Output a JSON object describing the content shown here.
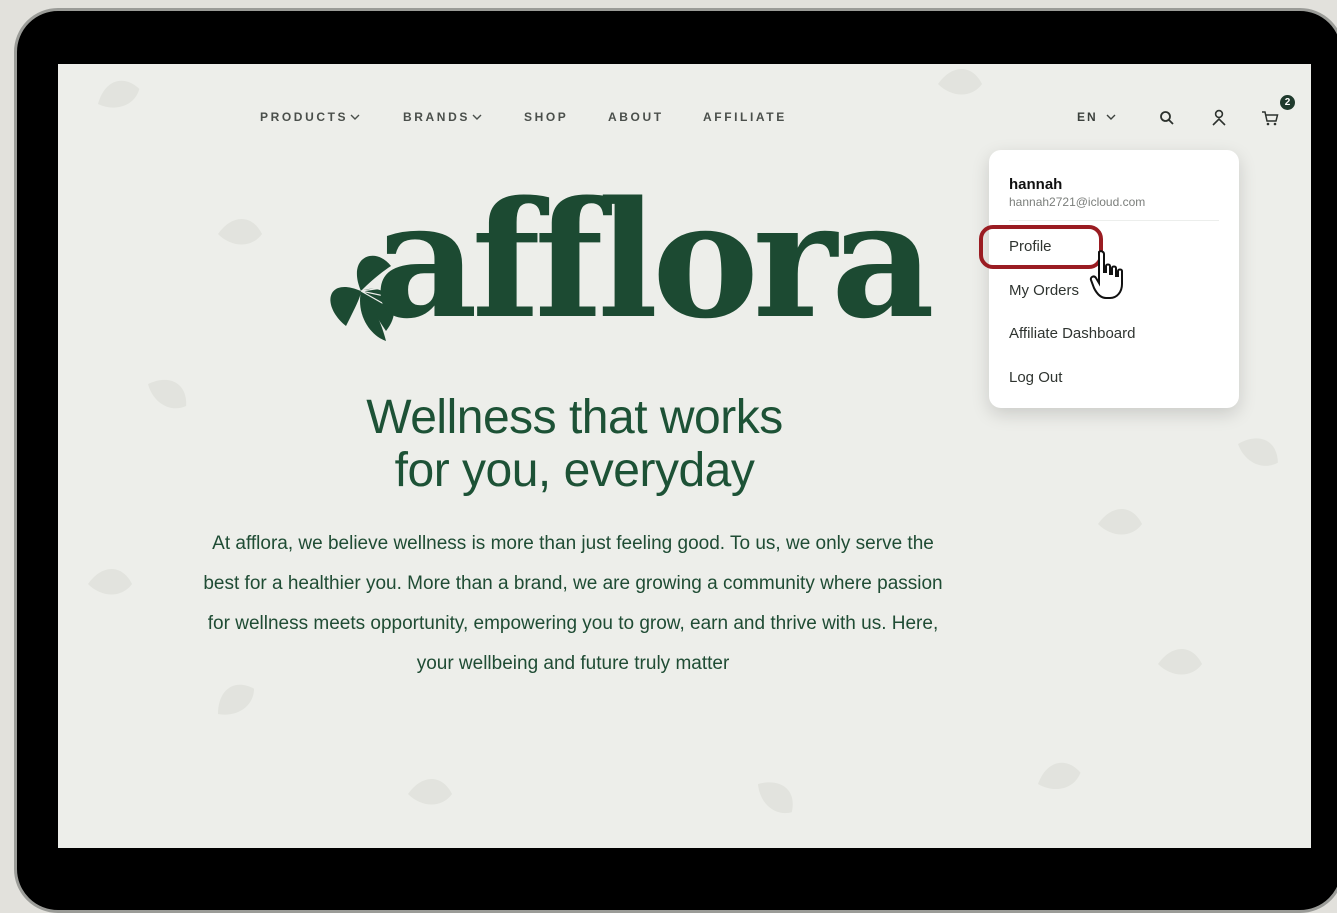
{
  "nav": {
    "items": [
      {
        "label": "PRODUCTS",
        "has_dropdown": true
      },
      {
        "label": "BRANDS",
        "has_dropdown": true
      },
      {
        "label": "SHOP",
        "has_dropdown": false
      },
      {
        "label": "ABOUT",
        "has_dropdown": false
      },
      {
        "label": "AFFILIATE",
        "has_dropdown": false
      }
    ],
    "language": "EN",
    "icons": [
      "search-icon",
      "user-icon",
      "cart-icon"
    ],
    "cart_count": "2"
  },
  "hero": {
    "logo_text": "afflora",
    "headline_line1": "Wellness that works",
    "headline_line2": "for you, everyday",
    "body": "At afflora, we believe wellness is more than just feeling good. To us, we only serve the best for a healthier you. More than a brand, we are growing a community where passion for wellness meets opportunity, empowering you to grow, earn and thrive with us. Here, your wellbeing and future truly matter"
  },
  "account_menu": {
    "user_name": "hannah",
    "user_email": "hannah2721@icloud.com",
    "items": [
      "Profile",
      "My Orders",
      "Affiliate Dashboard",
      "Log Out"
    ],
    "highlighted_item": "Profile"
  },
  "colors": {
    "brand_green": "#1c4a32",
    "highlight_red": "#9a1c22",
    "device_frame": "#000000",
    "page_bg": "#edeeea"
  }
}
